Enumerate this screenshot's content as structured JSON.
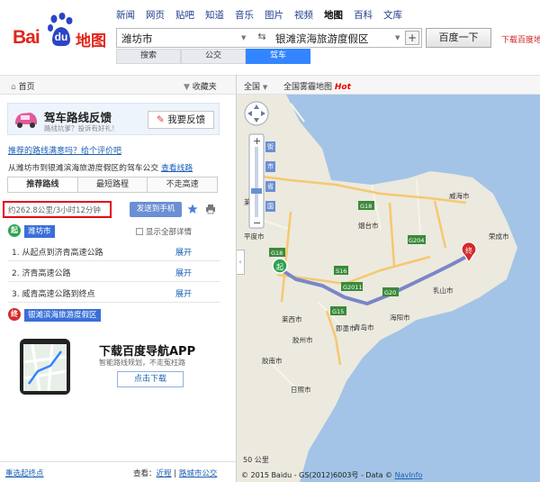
{
  "header": {
    "logo_text_bai": "Bai",
    "logo_text_du": "du",
    "logo_text_ditu": "地图",
    "nav": [
      "新闻",
      "网页",
      "贴吧",
      "知道",
      "音乐",
      "图片",
      "视频",
      "地图",
      "百科",
      "文库"
    ],
    "nav_active": "地图",
    "search_from": "潍坊市",
    "search_to": "银滩滨海旅游度假区",
    "search_button": "百度一下",
    "feedback_link": "下载百度地",
    "mode_tabs": [
      "搜索",
      "公交",
      "驾车"
    ],
    "mode_active": "驾车"
  },
  "left": {
    "home": "首页",
    "favorites": "收藏夹",
    "banner_title": "驾车路线反馈",
    "banner_sub": "路线坑爹？投诉有好礼！",
    "banner_button": "我要反馈",
    "recommend_link": "推荐的路线满意吗？给个评价吧",
    "desc_text": "从潍坊市到银滩滨海旅游度假区的驾车公交",
    "desc_link": "查看线路",
    "route_tabs": [
      "推荐路线",
      "最短路程",
      "不走高速"
    ],
    "route_tab_active": "推荐路线",
    "distance": "约262.8公里/3小时12分钟",
    "send_button": "发送到手机",
    "start_badge": "起",
    "start_place": "潍坊市",
    "show_all": "显示全部详情",
    "steps": [
      {
        "num": "1.",
        "text": "从起点到济青高速公路",
        "action": "展开"
      },
      {
        "num": "2.",
        "text": "济青高速公路",
        "action": "展开"
      },
      {
        "num": "3.",
        "text": "威青高速公路到终点",
        "action": "展开"
      }
    ],
    "end_badge": "终",
    "end_place": "银滩滨海旅游度假区",
    "app_title": "下载百度导航APP",
    "app_sub": "智能路线规划，不走冤枉路",
    "app_button": "点击下载",
    "bottom_left": "重选起终点",
    "bottom_see": "查看：",
    "bottom_link1": "近程",
    "bottom_sep": "|",
    "bottom_link2": "路城市公交"
  },
  "map": {
    "header_region": "全国",
    "header_label": "全国雾霾地图",
    "header_hot": "Hot",
    "zoom_levels": [
      "街",
      "市",
      "省",
      "国"
    ],
    "places": [
      "莱州市",
      "G18",
      "G204",
      "威海市",
      "烟台市",
      "S16",
      "G2011",
      "G15",
      "莱西市",
      "即墨市",
      "青岛市",
      "胶州市",
      "胶南市",
      "日照市",
      "海阳市",
      "乳山市",
      "荣成市",
      "G20",
      "平度市"
    ],
    "start_marker": "起",
    "end_marker": "终",
    "scale": "50 公里",
    "copyright": "© 2015 Baidu - GS(2012)6003号 - Data ©",
    "copyright_link": "NavInfo",
    "accent_color": "#3385ff",
    "route_color": "#7a86c7"
  }
}
